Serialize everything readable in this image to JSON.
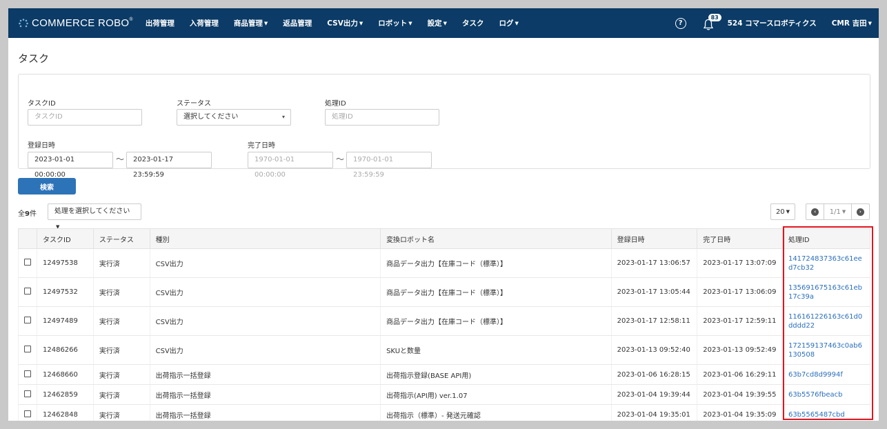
{
  "header": {
    "logo_text": "COMMERCE ROBO",
    "logo_sup": "®",
    "nav": [
      {
        "label": "出荷管理",
        "dropdown": false
      },
      {
        "label": "入荷管理",
        "dropdown": false
      },
      {
        "label": "商品管理",
        "dropdown": true
      },
      {
        "label": "返品管理",
        "dropdown": false
      },
      {
        "label": "CSV出力",
        "dropdown": true
      },
      {
        "label": "ロボット",
        "dropdown": true
      },
      {
        "label": "設定",
        "dropdown": true
      },
      {
        "label": "タスク",
        "dropdown": false
      },
      {
        "label": "ログ",
        "dropdown": true
      }
    ],
    "notification_count": "83",
    "company": "524 コマースロボティクス",
    "user": "CMR 吉田",
    "colors": {
      "bar": "#0b3b66",
      "accent": "#2d73b8",
      "link": "#2a6ebd",
      "highlight": "#e1141f"
    }
  },
  "page": {
    "title": "タスク"
  },
  "filters": {
    "task_id": {
      "label": "タスクID",
      "placeholder": "タスクID",
      "value": ""
    },
    "status": {
      "label": "ステータス",
      "value": "選択してください"
    },
    "process_id": {
      "label": "処理ID",
      "placeholder": "処理ID",
      "value": ""
    },
    "registered": {
      "label": "登録日時",
      "from": "2023-01-01 00:00:00",
      "to": "2023-01-17 23:59:59"
    },
    "completed": {
      "label": "完了日時",
      "from": "1970-01-01 00:00:00",
      "to": "1970-01-01 23:59:59"
    },
    "tilde": "〜"
  },
  "search_button": "検索",
  "toolbar": {
    "count_prefix": "全",
    "count": "9",
    "count_suffix": "件",
    "action_select": "処理を選択してください",
    "per_page": "20",
    "page_info": "1/1"
  },
  "table": {
    "columns": [
      "タスクID",
      "ステータス",
      "種別",
      "変換ロボット名",
      "登録日時",
      "完了日時",
      "処理ID"
    ],
    "rows": [
      {
        "id": "12497538",
        "status": "実行済",
        "type": "CSV出力",
        "robot": "商品データ出力【在庫コード（標準）】",
        "registered": "2023-01-17 13:06:57",
        "completed": "2023-01-17 13:07:09",
        "process_id": "141724837363c61eed7cb32"
      },
      {
        "id": "12497532",
        "status": "実行済",
        "type": "CSV出力",
        "robot": "商品データ出力【在庫コード（標準）】",
        "registered": "2023-01-17 13:05:44",
        "completed": "2023-01-17 13:06:09",
        "process_id": "135691675163c61eb17c39a"
      },
      {
        "id": "12497489",
        "status": "実行済",
        "type": "CSV出力",
        "robot": "商品データ出力【在庫コード（標準）】",
        "registered": "2023-01-17 12:58:11",
        "completed": "2023-01-17 12:59:11",
        "process_id": "116161226163c61d0dddd22"
      },
      {
        "id": "12486266",
        "status": "実行済",
        "type": "CSV出力",
        "robot": "SKUと数量",
        "registered": "2023-01-13 09:52:40",
        "completed": "2023-01-13 09:52:49",
        "process_id": "172159137463c0ab6130508"
      },
      {
        "id": "12468660",
        "status": "実行済",
        "type": "出荷指示一括登録",
        "robot": "出荷指示登録(BASE API用)",
        "registered": "2023-01-06 16:28:15",
        "completed": "2023-01-06 16:29:11",
        "process_id": "63b7cd8d9994f"
      },
      {
        "id": "12462859",
        "status": "実行済",
        "type": "出荷指示一括登録",
        "robot": "出荷指示(API用) ver.1.07",
        "registered": "2023-01-04 19:39:44",
        "completed": "2023-01-04 19:39:55",
        "process_id": "63b5576fbeacb"
      },
      {
        "id": "12462848",
        "status": "実行済",
        "type": "出荷指示一括登録",
        "robot": "出荷指示（標準）- 発送元確認",
        "registered": "2023-01-04 19:35:01",
        "completed": "2023-01-04 19:35:09",
        "process_id": "63b5565487cbd"
      }
    ]
  }
}
